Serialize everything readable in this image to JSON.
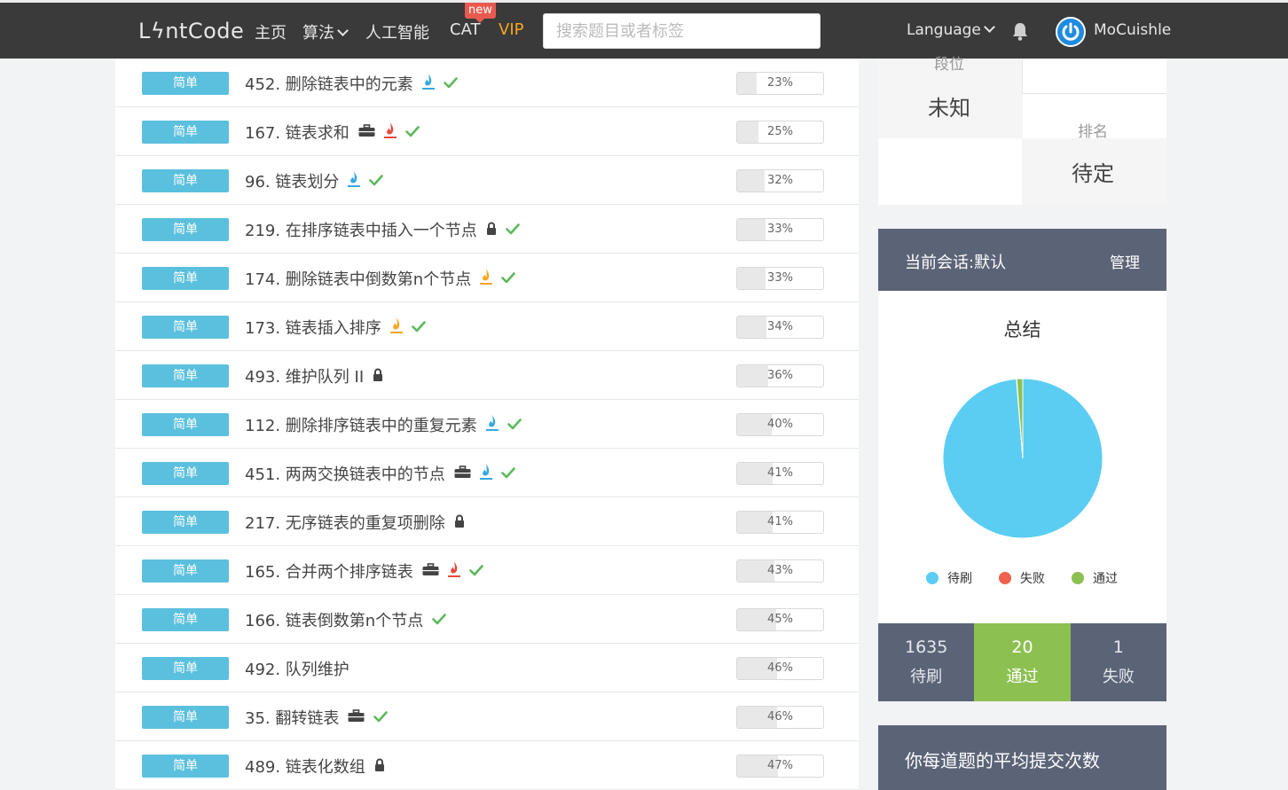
{
  "nav": {
    "logo": "LϟntCode",
    "home": "主页",
    "algorithm": "算法",
    "ai": "人工智能",
    "cat": "CAT",
    "new_badge": "new",
    "vip": "VIP",
    "search_placeholder": "搜索题目或者标签",
    "language": "Language",
    "username": "MoCuishle"
  },
  "colors": {
    "nav_bg": "#3a3a3a",
    "difficulty_easy": "#5bc0de",
    "panel_header": "#5b6477",
    "pass_green": "#8cc152",
    "pending_blue": "#5bcdf2",
    "fail_red": "#f0604d",
    "check_green": "#5cb85c"
  },
  "problems": [
    {
      "difficulty": "简单",
      "title": "452. 删除链表中的元素",
      "icons": [
        "flame-blue-icon",
        "check-icon"
      ],
      "rate": "23%",
      "rate_value": 23
    },
    {
      "difficulty": "简单",
      "title": "167. 链表求和",
      "icons": [
        "briefcase-icon",
        "flame-red-icon",
        "check-icon"
      ],
      "rate": "25%",
      "rate_value": 25
    },
    {
      "difficulty": "简单",
      "title": "96. 链表划分",
      "icons": [
        "flame-blue-icon",
        "check-icon"
      ],
      "rate": "32%",
      "rate_value": 32
    },
    {
      "difficulty": "简单",
      "title": "219. 在排序链表中插入一个节点",
      "icons": [
        "lock-icon",
        "check-icon"
      ],
      "rate": "33%",
      "rate_value": 33
    },
    {
      "difficulty": "简单",
      "title": "174. 删除链表中倒数第n个节点",
      "icons": [
        "flame-orange-icon",
        "check-icon"
      ],
      "rate": "33%",
      "rate_value": 33
    },
    {
      "difficulty": "简单",
      "title": "173. 链表插入排序",
      "icons": [
        "flame-orange-icon",
        "check-icon"
      ],
      "rate": "34%",
      "rate_value": 34
    },
    {
      "difficulty": "简单",
      "title": "493. 维护队列 II",
      "icons": [
        "lock-icon"
      ],
      "rate": "36%",
      "rate_value": 36
    },
    {
      "difficulty": "简单",
      "title": "112. 删除排序链表中的重复元素",
      "icons": [
        "flame-blue-icon",
        "check-icon"
      ],
      "rate": "40%",
      "rate_value": 40
    },
    {
      "difficulty": "简单",
      "title": "451. 两两交换链表中的节点",
      "icons": [
        "briefcase-icon",
        "flame-blue-icon",
        "check-icon"
      ],
      "rate": "41%",
      "rate_value": 41
    },
    {
      "difficulty": "简单",
      "title": "217. 无序链表的重复项删除",
      "icons": [
        "lock-icon"
      ],
      "rate": "41%",
      "rate_value": 41
    },
    {
      "difficulty": "简单",
      "title": "165. 合并两个排序链表",
      "icons": [
        "briefcase-icon",
        "flame-red-icon",
        "check-icon"
      ],
      "rate": "43%",
      "rate_value": 43
    },
    {
      "difficulty": "简单",
      "title": "166. 链表倒数第n个节点",
      "icons": [
        "check-icon"
      ],
      "rate": "45%",
      "rate_value": 45
    },
    {
      "difficulty": "简单",
      "title": "492. 队列维护",
      "icons": [],
      "rate": "46%",
      "rate_value": 46
    },
    {
      "difficulty": "简单",
      "title": "35. 翻转链表",
      "icons": [
        "briefcase-icon",
        "check-icon"
      ],
      "rate": "46%",
      "rate_value": 46
    },
    {
      "difficulty": "简单",
      "title": "489. 链表化数组",
      "icons": [
        "lock-icon"
      ],
      "rate": "47%",
      "rate_value": 47
    }
  ],
  "rank": {
    "tier_label": "段位",
    "tier_value": "未知",
    "rank_label": "排名",
    "rank_value": "待定"
  },
  "session": {
    "title": "当前会话:默认",
    "manage": "管理",
    "summary_title": "总结",
    "legend": [
      {
        "label": "待刷",
        "color": "#5bcdf2"
      },
      {
        "label": "失败",
        "color": "#f0604d"
      },
      {
        "label": "通过",
        "color": "#8cc152"
      }
    ],
    "stats": [
      {
        "num": "1635",
        "label": "待刷"
      },
      {
        "num": "20",
        "label": "通过"
      },
      {
        "num": "1",
        "label": "失败"
      }
    ]
  },
  "chart_data": {
    "type": "pie",
    "title": "总结",
    "categories": [
      "待刷",
      "失败",
      "通过"
    ],
    "values": [
      1635,
      1,
      20
    ],
    "colors": [
      "#5bcdf2",
      "#f0604d",
      "#8cc152"
    ],
    "legend": "bottom"
  },
  "avg": {
    "title": "你每道题的平均提交次数"
  }
}
